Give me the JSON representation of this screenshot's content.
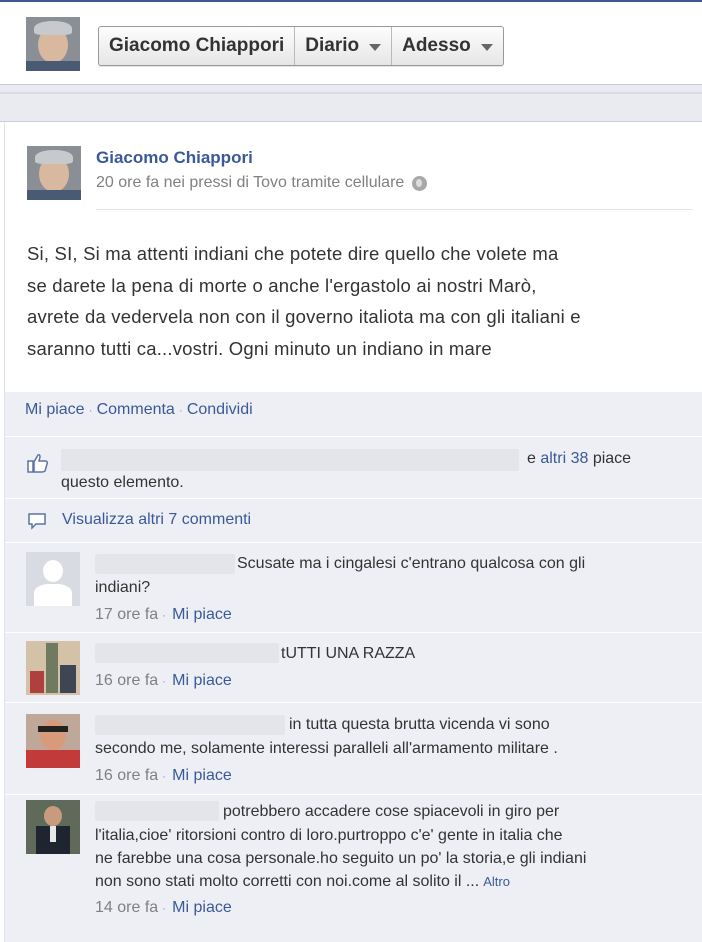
{
  "topbar": {
    "profile_name": "Giacomo Chiappori",
    "diario_label": "Diario",
    "adesso_label": "Adesso"
  },
  "post": {
    "author": "Giacomo Chiappori",
    "meta": "20 ore fa nei pressi di Tovo tramite cellulare",
    "lines": [
      "Si, SI, Si ma attenti indiani che potete dire quello che volete ma",
      "se darete la pena di morte o anche l'ergastolo ai nostri Marò,",
      "avrete da vedervela non con il governo italiota ma con gli italiani e",
      "saranno tutti ca...vostri. Ogni minuto un indiano in mare"
    ],
    "actions": {
      "like": "Mi piace",
      "comment": "Commenta",
      "share": "Condividi"
    }
  },
  "likes": {
    "prefix": "e ",
    "others_link": "altri 38",
    "suffix": " piace",
    "line2": "questo elemento."
  },
  "view_more": "Visualizza altri 7 commenti",
  "comments": [
    {
      "line1": "Scusate ma i cingalesi c'entrano qualcosa con gli",
      "line2": "indiani?",
      "time": "17 ore fa",
      "like": "Mi piace"
    },
    {
      "line1": "tUTTI UNA RAZZA",
      "time": "16 ore fa",
      "like": "Mi piace"
    },
    {
      "line1": "in tutta questa brutta vicenda vi sono",
      "line2": "secondo me, solamente interessi paralleli all'armamento militare .",
      "time": "16 ore fa",
      "like": "Mi piace"
    },
    {
      "line1": "potrebbero accadere cose spiacevoli in giro per",
      "line2": "l'italia,cioe' ritorsioni contro di loro.purtroppo c'e' gente in italia che",
      "line3": "ne farebbe una cosa personale.ho seguito un po' la storia,e gli indiani",
      "line4": "non sono stati molto corretti con noi.come al solito il ...",
      "more": "Altro",
      "time": "14 ore fa",
      "like": "Mi piace"
    }
  ],
  "colors": {
    "fb_blue": "#3b5998",
    "ufi_bg": "#edeff4",
    "meta_gray": "#808080"
  }
}
